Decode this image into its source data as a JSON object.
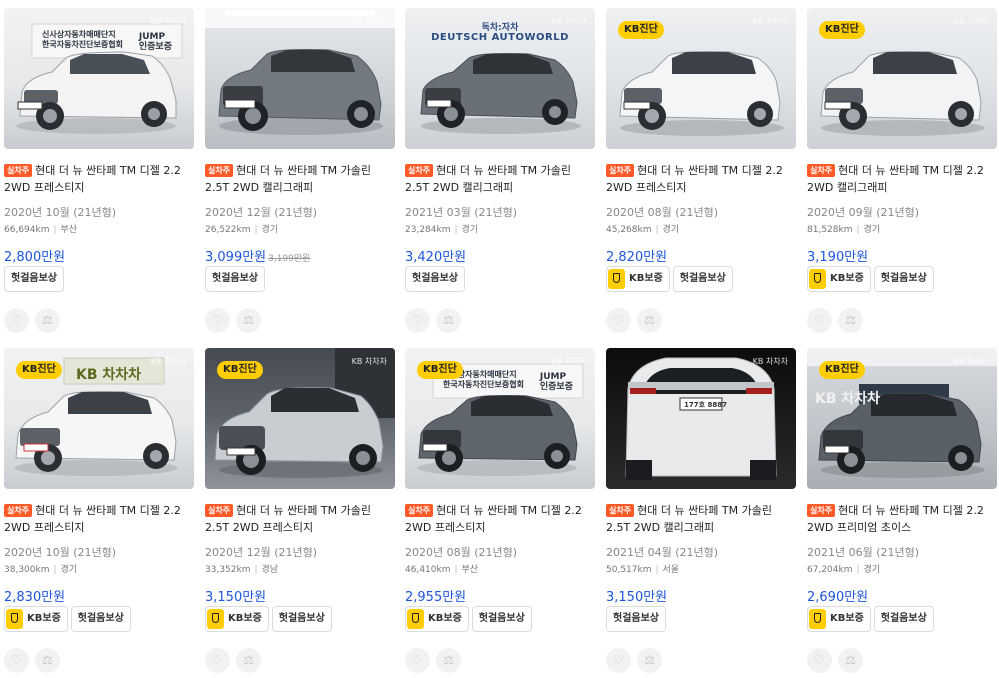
{
  "badge_label": "실차주",
  "kb_tag_label": "KB진단",
  "watermark": "KB 차차차",
  "sign_main": "신사상자동차매매단지",
  "sign_sub": "한국자동차진단보증협회",
  "sign_jump": "JUMP",
  "sign_jump_sub": "인증보증",
  "sign_dealer_top": "독차:자차",
  "sign_dealer": "DEUTSCH AUTOWORLD",
  "sign_kb_wall": "KB 차차차",
  "plate_pill": "177호 8887",
  "kb_guarantee_label": "KB보증",
  "warranty_label": "헛걸음보상",
  "wish_icon": "heart-icon",
  "compare_icon": "scale-icon",
  "colors": {
    "accent": "#ff5a28",
    "price": "#1e56d9",
    "kb": "#ffcd00"
  },
  "cars": [
    {
      "title": "현대 더 뉴 싼타페 TM 디젤 2.2 2WD 프레스티지",
      "year": "2020년 10월 (21년형)",
      "mileage": "66,694km",
      "region": "부산",
      "price": "2,800만원",
      "old_price": "",
      "kb": false
    },
    {
      "title": "현대 더 뉴 싼타페 TM 가솔린 2.5T 2WD 캘리그래피",
      "year": "2020년 12월 (21년형)",
      "mileage": "26,522km",
      "region": "경기",
      "price": "3,099만원",
      "old_price": "3,199만원",
      "kb": false
    },
    {
      "title": "현대 더 뉴 싼타페 TM 가솔린 2.5T 2WD 캘리그래피",
      "year": "2021년 03월 (21년형)",
      "mileage": "23,284km",
      "region": "경기",
      "price": "3,420만원",
      "old_price": "",
      "kb": false
    },
    {
      "title": "현대 더 뉴 싼타페 TM 디젤 2.2 2WD 프레스티지",
      "year": "2020년 08월 (21년형)",
      "mileage": "45,268km",
      "region": "경기",
      "price": "2,820만원",
      "old_price": "",
      "kb": true
    },
    {
      "title": "현대 더 뉴 싼타페 TM 디젤 2.2 2WD 캘리그래피",
      "year": "2020년 09월 (21년형)",
      "mileage": "81,528km",
      "region": "경기",
      "price": "3,190만원",
      "old_price": "",
      "kb": true
    },
    {
      "title": "현대 더 뉴 싼타페 TM 디젤 2.2 2WD 프레스티지",
      "year": "2020년 10월 (21년형)",
      "mileage": "38,300km",
      "region": "경기",
      "price": "2,830만원",
      "old_price": "",
      "kb": true
    },
    {
      "title": "현대 더 뉴 싼타페 TM 가솔린 2.5T 2WD 프레스티지",
      "year": "2020년 12월 (21년형)",
      "mileage": "33,352km",
      "region": "경남",
      "price": "3,150만원",
      "old_price": "",
      "kb": true
    },
    {
      "title": "현대 더 뉴 싼타페 TM 디젤 2.2 2WD 프레스티지",
      "year": "2020년 08월 (21년형)",
      "mileage": "46,410km",
      "region": "부산",
      "price": "2,955만원",
      "old_price": "",
      "kb": true
    },
    {
      "title": "현대 더 뉴 싼타페 TM 가솔린 2.5T 2WD 캘리그래피",
      "year": "2021년 04월 (21년형)",
      "mileage": "50,517km",
      "region": "서울",
      "price": "3,150만원",
      "old_price": "",
      "kb": false
    },
    {
      "title": "현대 더 뉴 싼타페 TM 디젤 2.2 2WD 프리미엄 초이스",
      "year": "2021년 06월 (21년형)",
      "mileage": "67,204km",
      "region": "경기",
      "price": "2,690만원",
      "old_price": "",
      "kb": true
    }
  ]
}
